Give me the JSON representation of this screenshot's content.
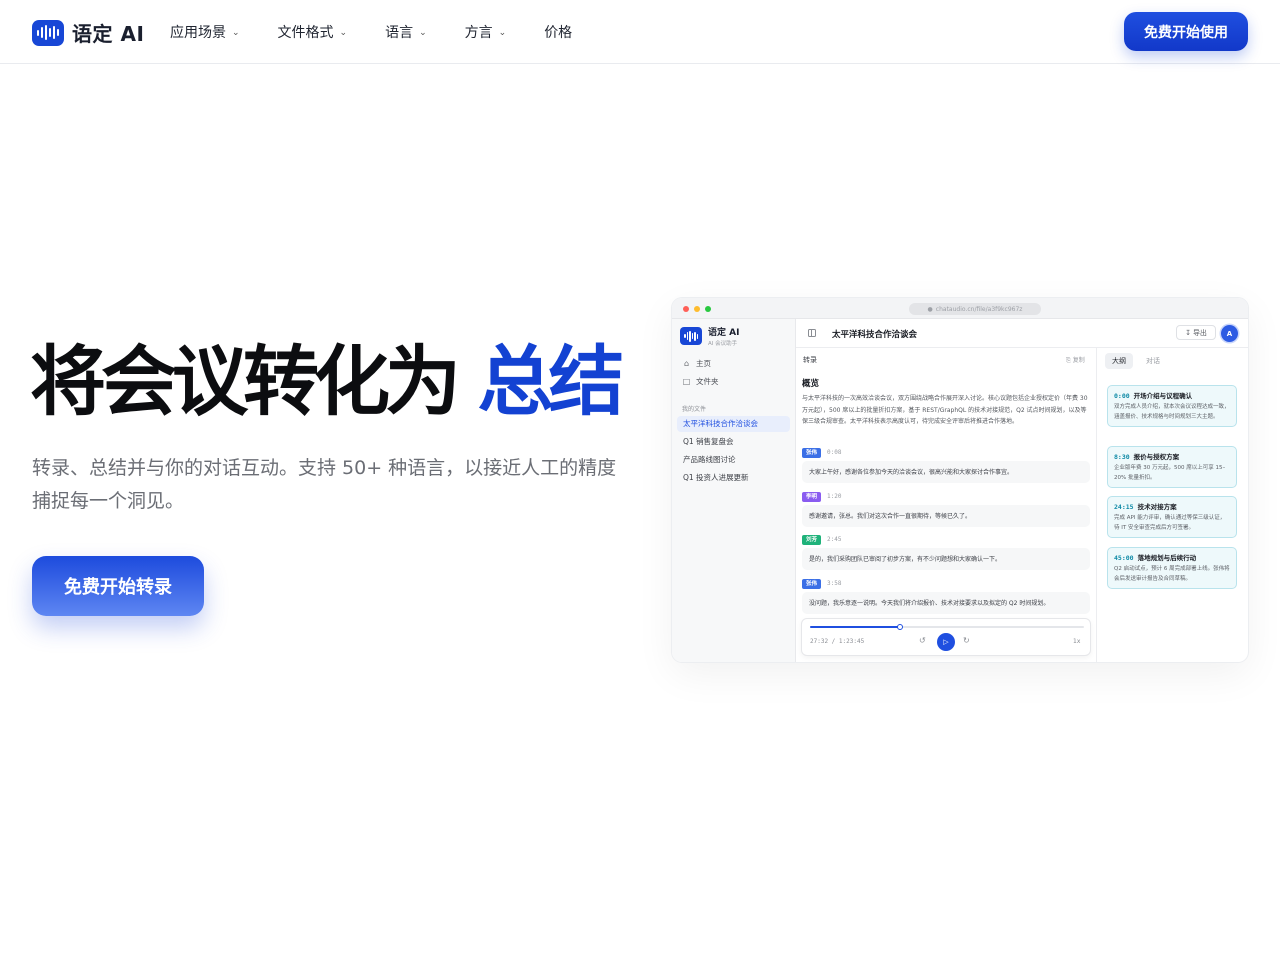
{
  "nav": {
    "logo_text": "语定 AI",
    "items": [
      {
        "label": "应用场景",
        "has_dropdown": true
      },
      {
        "label": "文件格式",
        "has_dropdown": true
      },
      {
        "label": "语言",
        "has_dropdown": true
      },
      {
        "label": "方言",
        "has_dropdown": true
      },
      {
        "label": "价格",
        "has_dropdown": false
      }
    ],
    "cta_label": "免费开始使用"
  },
  "hero": {
    "title_main": "将会议转化为",
    "title_accent": "总结",
    "subtitle": "转录、总结并与你的对话互动。支持 50+ 种语言，以接近人工的精度捕捉每一个洞见。",
    "cta_label": "免费开始转录"
  },
  "preview": {
    "url": "chataudio.cn/file/a3f9kc967z",
    "sidebar": {
      "app_name": "语定 AI",
      "app_sub": "AI 会议助手",
      "nav": [
        {
          "label": "主页",
          "icon": "home-icon"
        },
        {
          "label": "文件夹",
          "icon": "folder-icon"
        }
      ],
      "section_label": "我的文件",
      "files": [
        {
          "label": "太平洋科技合作洽谈会",
          "active": true
        },
        {
          "label": "Q1 销售复盘会",
          "active": false
        },
        {
          "label": "产品路线图讨论",
          "active": false
        },
        {
          "label": "Q1 投资人进展更新",
          "active": false
        }
      ]
    },
    "header": {
      "title": "太平洋科技合作洽谈会",
      "export_label": "导出",
      "avatar_letter": "A"
    },
    "transcript": {
      "tab_label": "转录",
      "copy_label": "复制",
      "overview_title": "概览",
      "overview_text": "与太平洋科技的一次高效洽谈会议，双方围绕战略合作展开深入讨论。核心议题包括企业授权定价（年费 30 万元起），500 席以上的批量折扣方案，基于 REST/GraphQL 的技术对接规范，Q2 试点时间规划，以及等保三级合规审查。太平洋科技表示高度认可，待完成安全评审后将推进合作落地。",
      "segments": [
        {
          "speaker": "张伟",
          "time": "0:08",
          "color": "#3b6fe6",
          "text": "大家上午好，感谢各位参加今天的洽谈会议，很高兴能和大家探讨合作事宜。"
        },
        {
          "speaker": "李明",
          "time": "1:20",
          "color": "#8a5cf0",
          "text": "感谢邀请，张总。我们对这次合作一直很期待，等候已久了。"
        },
        {
          "speaker": "刘芳",
          "time": "2:45",
          "color": "#1fb27a",
          "text": "是的，我们采购团队已审阅了初步方案，有不少问题想和大家确认一下。"
        },
        {
          "speaker": "张伟",
          "time": "3:58",
          "color": "#3b6fe6",
          "text": "没问题，我乐意逐一说明。今天我们将介绍报价、技术对接要求以及拟定的 Q2 时间规划。"
        }
      ],
      "player": {
        "current": "27:32",
        "total": "1:23:45",
        "progress": 0.33,
        "speed": "1x"
      }
    },
    "outline": {
      "tabs": [
        {
          "label": "大纲",
          "active": true
        },
        {
          "label": "对话",
          "active": false
        }
      ],
      "items": [
        {
          "time": "0:00",
          "title": "开场介绍与议程确认",
          "text": "双方完成人员介绍，就本次会议议程达成一致，涵盖报价、技术规格与时间规划三大主题。"
        },
        {
          "time": "8:30",
          "title": "报价与授权方案",
          "text": "企业版年费 30 万元起，500 席以上可享 15–20% 批量折扣。"
        },
        {
          "time": "24:15",
          "title": "技术对接方案",
          "text": "完成 API 能力评审，确认通过等保三级认证，待 IT 安全审查完成后方可签署。"
        },
        {
          "time": "45:00",
          "title": "落地规划与后续行动",
          "text": "Q2 启动试点，预计 6 周完成部署上线。张伟将会后发送审计报告及合同草稿。"
        }
      ]
    }
  },
  "colors": {
    "brand": "#1847d6",
    "accent_text": "#1342d2",
    "outline_time": "#0e8aa6"
  }
}
